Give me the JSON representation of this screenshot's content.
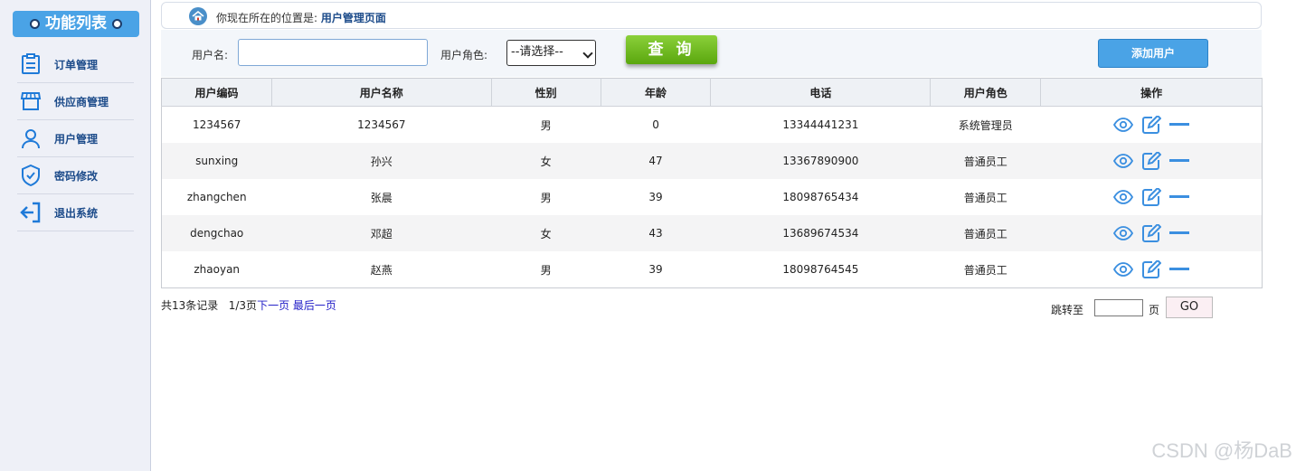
{
  "sidebar": {
    "title": "功能列表",
    "items": [
      {
        "label": "订单管理",
        "icon": "clipboard-icon"
      },
      {
        "label": "供应商管理",
        "icon": "store-icon"
      },
      {
        "label": "用户管理",
        "icon": "user-icon"
      },
      {
        "label": "密码修改",
        "icon": "shield-check-icon"
      },
      {
        "label": "退出系统",
        "icon": "logout-icon"
      }
    ]
  },
  "breadcrumb": {
    "prefix": "你现在所在的位置是:",
    "current": "用户管理页面"
  },
  "search": {
    "username_label": "用户名:",
    "username_value": "",
    "role_label": "用户角色:",
    "role_selected": "--请选择--",
    "query_button": "查 询",
    "add_button": "添加用户"
  },
  "table": {
    "headers": [
      "用户编码",
      "用户名称",
      "性别",
      "年龄",
      "电话",
      "用户角色",
      "操作"
    ],
    "rows": [
      {
        "code": "1234567",
        "name": "1234567",
        "gender": "男",
        "age": "0",
        "phone": "13344441231",
        "role": "系统管理员"
      },
      {
        "code": "sunxing",
        "name": "孙兴",
        "gender": "女",
        "age": "47",
        "phone": "13367890900",
        "role": "普通员工"
      },
      {
        "code": "zhangchen",
        "name": "张晨",
        "gender": "男",
        "age": "39",
        "phone": "18098765434",
        "role": "普通员工"
      },
      {
        "code": "dengchao",
        "name": "邓超",
        "gender": "女",
        "age": "43",
        "phone": "13689674534",
        "role": "普通员工"
      },
      {
        "code": "zhaoyan",
        "name": "赵燕",
        "gender": "男",
        "age": "39",
        "phone": "18098764545",
        "role": "普通员工"
      }
    ]
  },
  "pager": {
    "total": "共13条记录",
    "page_info": "1/3页",
    "next": "下一页",
    "last": "最后一页",
    "jump_label": "跳转至",
    "jump_value": "",
    "page_suffix": "页",
    "go": "GO"
  },
  "watermark": "CSDN @杨DaB",
  "colors": {
    "accent": "#4aa3e6",
    "query_green": "#6cb41a",
    "link": "#2420c8",
    "icon_blue": "#3b8fe0"
  }
}
